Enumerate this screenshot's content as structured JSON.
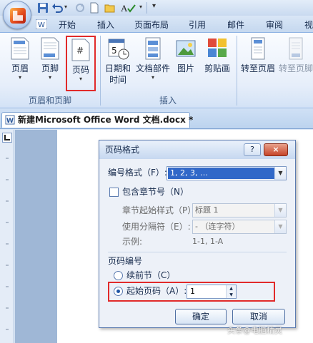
{
  "tabs": [
    "开始",
    "插入",
    "页面布局",
    "引用",
    "邮件",
    "审阅",
    "视图"
  ],
  "ribbon": {
    "buttons": [
      {
        "label": "页眉",
        "caret": "▾"
      },
      {
        "label": "页脚",
        "caret": "▾"
      },
      {
        "label": "页码",
        "caret": "▾"
      },
      {
        "label": "日期和时间",
        "label_lines": [
          "日期和",
          "时间"
        ]
      },
      {
        "label": "文档部件",
        "caret": "▾"
      },
      {
        "label": "图片"
      },
      {
        "label": "剪贴画"
      },
      {
        "label": "转至页眉"
      },
      {
        "label": "转至页脚"
      }
    ],
    "groups": [
      "页眉和页脚",
      "插入"
    ]
  },
  "document_tab": "新建Microsoft Office Word 文档.docx *",
  "dialog": {
    "title": "页码格式",
    "help": "?",
    "close": "×",
    "number_format_label": "编号格式（F）:",
    "number_format_value": "1, 2, 3, …",
    "include_chapter_label": "包含章节号（N）",
    "chapter_style_label": "章节起始样式（P）",
    "chapter_style_value": "标题 1",
    "separator_label": "使用分隔符（E）:",
    "separator_value": "-  （连字符）",
    "example_label": "示例:",
    "example_value": "1-1, 1-A",
    "numbering_label": "页码编号",
    "continue_label": "续前节（C）",
    "start_at_label": "起始页码（A）:",
    "start_at_value": "1",
    "ok_label": "确定",
    "cancel_label": "取消"
  },
  "watermark": "头条@电脑精灵",
  "colors": {
    "highlight": "#e12a2a",
    "selection": "#3168c8"
  }
}
